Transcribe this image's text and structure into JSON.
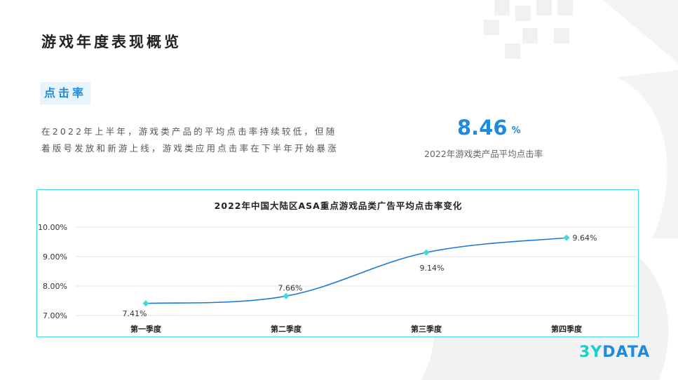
{
  "page": {
    "title": "游戏年度表现概览",
    "section_tag": "点击率",
    "description": "在2022年上半年，游戏类产品的平均点击率持续较低，但随着版号发放和新游上线，游戏类应用点击率在下半年开始暴涨",
    "kpi": {
      "value": "8.46",
      "unit": "%",
      "label": "2022年游戏类产品平均点击率"
    },
    "brand": {
      "prefix": "3Y",
      "suffix": "DATA"
    }
  },
  "colors": {
    "accent_blue": "#1e8ae0",
    "line": "#1a78d8",
    "marker": "#3dd9dc",
    "frame": "#45dce0",
    "grid": "#e3e3e3"
  },
  "chart_data": {
    "type": "line",
    "title": "2022年中国大陆区ASA重点游戏品类广告平均点击率变化",
    "categories": [
      "第一季度",
      "第二季度",
      "第三季度",
      "第四季度"
    ],
    "series": [
      {
        "values": [
          7.41,
          7.66,
          9.14,
          9.64
        ],
        "labels": [
          "7.41%",
          "7.66%",
          "9.14%",
          "9.64%"
        ]
      }
    ],
    "yticks": [
      "7.00%",
      "8.00%",
      "9.00%",
      "10.00%"
    ],
    "ylim": [
      7.0,
      10.0
    ],
    "ytick_values": [
      7,
      8,
      9,
      10
    ],
    "grid": true,
    "smooth": true,
    "marker": "diamond"
  }
}
